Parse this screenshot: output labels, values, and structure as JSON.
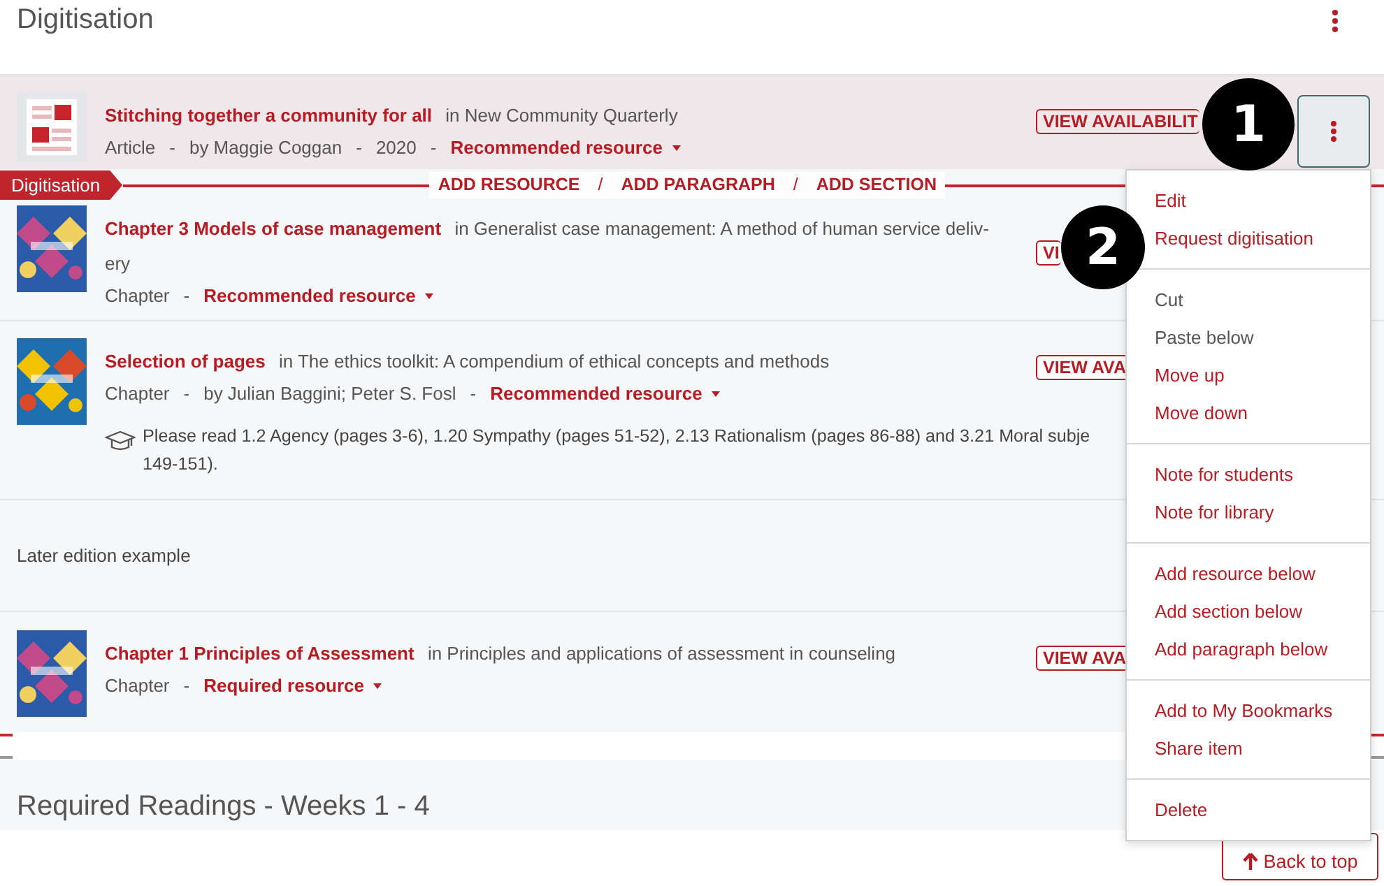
{
  "header": {
    "title": "Digitisation"
  },
  "items": [
    {
      "kind": "resource",
      "selected": true,
      "thumbnail": {
        "kind": "icon"
      },
      "title": "Stitching together a community for all",
      "source": [
        "in New Community Quarterly"
      ],
      "meta": [
        "Article",
        "-",
        "by Maggie Coggan",
        "-",
        "2020",
        "-"
      ],
      "importance": "Recommended resource",
      "availability": "VIEW AVAILABILIT"
    },
    {
      "kind": "divider",
      "tag": "Digitisation",
      "actions": [
        "ADD RESOURCE",
        "/",
        "ADD PARAGRAPH",
        "/",
        "ADD SECTION"
      ]
    },
    {
      "kind": "resource",
      "selected": false,
      "thumbnail": {
        "kind": "picture"
      },
      "title": "Chapter 3 Models of case management",
      "source": [
        "in Generalist case management: A method of human service deliv-",
        "ery"
      ],
      "meta": [
        "Chapter",
        "-"
      ],
      "importance": "Recommended resource",
      "availability": "VI"
    },
    {
      "kind": "resource",
      "selected": false,
      "thumbnail": {
        "kind": "picture"
      },
      "title": "Selection of pages",
      "source": [
        "in The ethics toolkit: A compendium of ethical concepts and methods"
      ],
      "meta": [
        "Chapter",
        "-",
        "by Julian Baggini; Peter S. Fosl",
        "-"
      ],
      "importance": "Recommended resource",
      "availability": "VIEW AVA",
      "note": [
        "Please read 1.2 Agency (pages 3-6), 1.20 Sympathy (pages 51-52), 2.13 Rationalism (pages 86-88) and 3.21 Moral subje",
        "149-151)."
      ]
    },
    {
      "kind": "paragraph",
      "selected": false,
      "text": "Later edition example"
    },
    {
      "kind": "resource",
      "selected": false,
      "thumbnail": {
        "kind": "picture"
      },
      "title": "Chapter 1 Principles of Assessment",
      "source": [
        "in Principles and applications of assessment in counseling"
      ],
      "meta": [
        "Chapter",
        "-"
      ],
      "importance": "Required resource",
      "availability": "VIEW AVA"
    }
  ],
  "next_section": {
    "title": "Required Readings - Weeks 1 - 4"
  },
  "menu": [
    [
      {
        "label": "Edit",
        "disabled": false
      },
      {
        "label": "Request digitisation",
        "disabled": false
      }
    ],
    [
      {
        "label": "Cut",
        "disabled": true
      },
      {
        "label": "Paste below",
        "disabled": true
      },
      {
        "label": "Move up",
        "disabled": false
      },
      {
        "label": "Move down",
        "disabled": false
      }
    ],
    [
      {
        "label": "Note for students",
        "disabled": false
      },
      {
        "label": "Note for library",
        "disabled": false
      }
    ],
    [
      {
        "label": "Add resource below",
        "disabled": false
      },
      {
        "label": "Add section below",
        "disabled": false
      },
      {
        "label": "Add paragraph below",
        "disabled": false
      }
    ],
    [
      {
        "label": "Add to My Bookmarks",
        "disabled": false
      },
      {
        "label": "Share item",
        "disabled": false
      }
    ],
    [
      {
        "label": "Delete",
        "disabled": false
      }
    ]
  ],
  "callouts": [
    "1",
    "2"
  ],
  "back_to_top": "Back to top"
}
